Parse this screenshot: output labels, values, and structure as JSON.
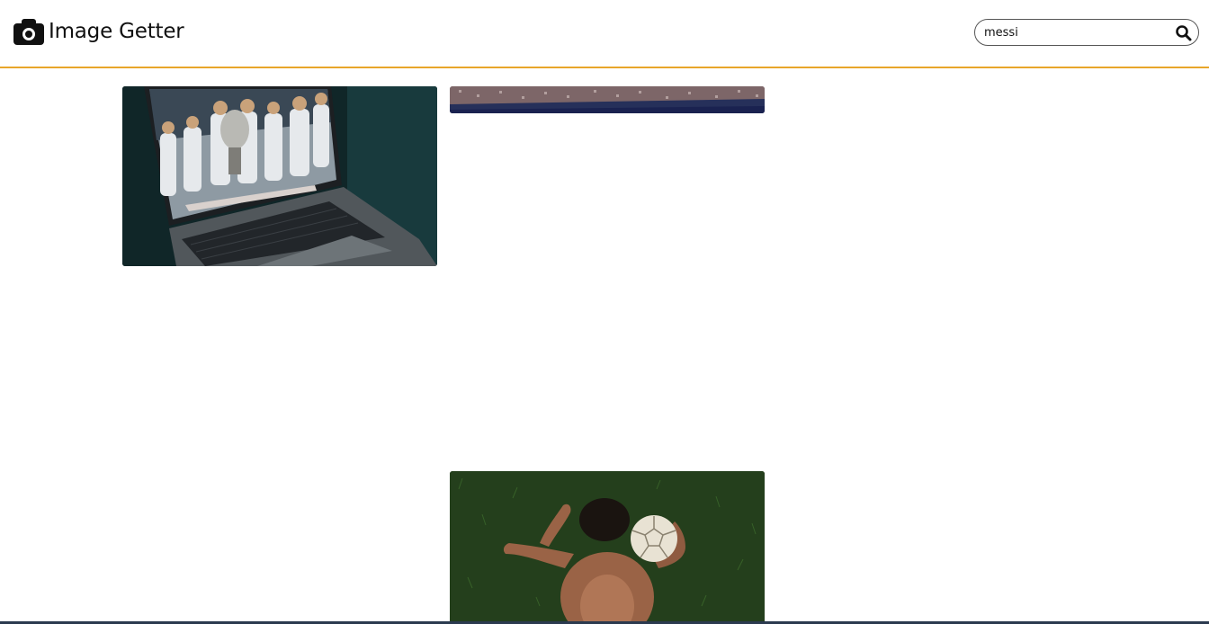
{
  "header": {
    "logo_icon": "camera-icon",
    "title": "Image Getter",
    "accent_color": "#e8a62a"
  },
  "search": {
    "value": "messi",
    "button_icon": "search-icon"
  },
  "results": [
    {
      "name": "laptop-argentina-players-trophy-photo"
    },
    {
      "name": "stadium-crowd-photo"
    },
    {
      "name": "boy-lying-on-grass-with-football-photo"
    }
  ]
}
